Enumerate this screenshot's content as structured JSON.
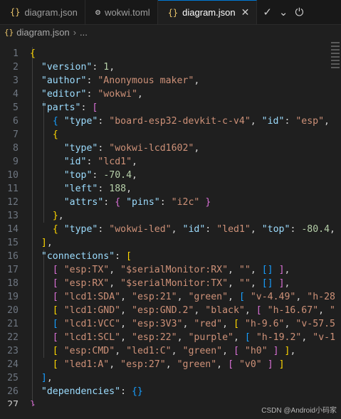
{
  "tabs": [
    {
      "icon": "{}",
      "label": "diagram.json",
      "active": false
    },
    {
      "icon": "⚙",
      "label": "wokwi.toml",
      "active": false
    },
    {
      "icon": "{}",
      "label": "diagram.json",
      "active": true
    }
  ],
  "breadcrumb": {
    "file": "diagram.json",
    "rest": "..."
  },
  "lines": [
    "{",
    "  \"version\": 1,",
    "  \"author\": \"Anonymous maker\",",
    "  \"editor\": \"wokwi\",",
    "  \"parts\": [",
    "    { \"type\": \"board-esp32-devkit-c-v4\", \"id\": \"esp\",",
    "    {",
    "      \"type\": \"wokwi-lcd1602\",",
    "      \"id\": \"lcd1\",",
    "      \"top\": -70.4,",
    "      \"left\": 188,",
    "      \"attrs\": { \"pins\": \"i2c\" }",
    "    },",
    "    { \"type\": \"wokwi-led\", \"id\": \"led1\", \"top\": -80.4,",
    "  ],",
    "  \"connections\": [",
    "    [ \"esp:TX\", \"$serialMonitor:RX\", \"\", [] ],",
    "    [ \"esp:RX\", \"$serialMonitor:TX\", \"\", [] ],",
    "    [ \"lcd1:SDA\", \"esp:21\", \"green\", [ \"v-4.49\", \"h-28",
    "    [ \"lcd1:GND\", \"esp:GND.2\", \"black\", [ \"h-16.67\", \"",
    "    [ \"lcd1:VCC\", \"esp:3V3\", \"red\", [ \"h-9.6\", \"v-57.5",
    "    [ \"lcd1:SCL\", \"esp:22\", \"purple\", [ \"h-19.2\", \"v-1",
    "    [ \"esp:CMD\", \"led1:C\", \"green\", [ \"h0\" ] ],",
    "    [ \"led1:A\", \"esp:27\", \"green\", [ \"v0\" ] ]",
    "  ],",
    "  \"dependencies\": {}",
    "}"
  ],
  "current_line": 27,
  "watermark": "CSDN @Android小码家",
  "colors": {
    "key": "#9cdcfe",
    "string": "#ce9178",
    "number": "#b5cea8",
    "bracket1": "#ffd700",
    "bracket2": "#da70d6",
    "bracket3": "#179fff"
  }
}
